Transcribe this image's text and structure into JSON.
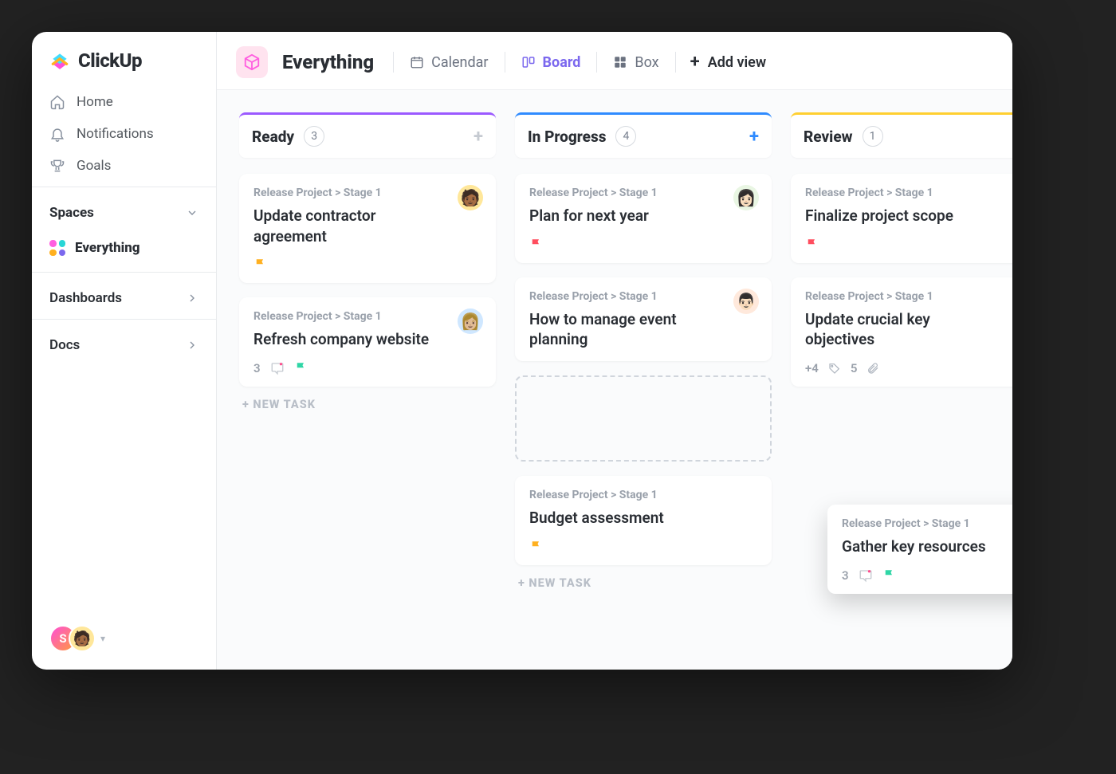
{
  "app_name": "ClickUp",
  "sidebar": {
    "nav": [
      {
        "label": "Home"
      },
      {
        "label": "Notifications"
      },
      {
        "label": "Goals"
      }
    ],
    "spaces_label": "Spaces",
    "everything_label": "Everything",
    "dashboards_label": "Dashboards",
    "docs_label": "Docs",
    "presence_initial": "S"
  },
  "topbar": {
    "space_title": "Everything",
    "views": {
      "calendar": "Calendar",
      "board": "Board",
      "box": "Box"
    },
    "add_view": "Add view"
  },
  "board": {
    "columns": [
      {
        "name": "Ready",
        "count": "3",
        "accent": "#9b59ff",
        "cards": [
          {
            "crumb": "Release Project > Stage 1",
            "title": "Update contractor agreement",
            "flag": "#ffb020",
            "avatar_bg": "#ffe79a"
          },
          {
            "crumb": "Release Project > Stage 1",
            "title": "Refresh company website",
            "comments": "3",
            "flag": "#2fd6a6",
            "avatar_bg": "#cfe7ff"
          }
        ],
        "new_task": "+ NEW TASK"
      },
      {
        "name": "In Progress",
        "count": "4",
        "accent": "#2f8bff",
        "add_active": true,
        "cards": [
          {
            "crumb": "Release Project > Stage 1",
            "title": "Plan for next year",
            "flag": "#ff4d5e",
            "avatar_bg": "#e9f6e3"
          },
          {
            "crumb": "Release Project > Stage 1",
            "title": "How to manage event planning",
            "avatar_bg": "#ffe9dc"
          },
          {
            "drop": true
          },
          {
            "crumb": "Release Project > Stage 1",
            "title": "Budget assessment",
            "flag": "#ffb020"
          }
        ],
        "new_task": "+ NEW TASK"
      },
      {
        "name": "Review",
        "count": "1",
        "accent": "#ffcf30",
        "cards": [
          {
            "crumb": "Release Project > Stage 1",
            "title": "Finalize project scope",
            "flag": "#ff4d5e"
          },
          {
            "crumb": "Release Project > Stage 1",
            "title": "Update crucial key objectives",
            "tags": "+4",
            "attachments": "5"
          }
        ]
      }
    ],
    "dragged": {
      "crumb": "Release Project > Stage 1",
      "title": "Gather key resources",
      "comments": "3",
      "flag": "#2fd6a6",
      "avatar_bg": "#ffe7c2"
    }
  }
}
